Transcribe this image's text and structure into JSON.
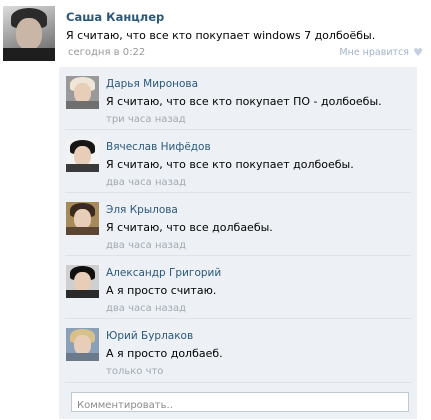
{
  "post": {
    "author": "Саша Канцлер",
    "text": "Я считаю, что все кто покупает windows 7 долбоёбы.",
    "date": "сегодня в 0:22",
    "like_label": "Мне нравится",
    "like_icon": "heart-icon"
  },
  "comments": [
    {
      "name": "Дарья Миронова",
      "text": "Я считаю, что все кто покупает ПО - долбоебы.",
      "time": "три часа назад",
      "avatar_colors": {
        "hair": "#efe6d8",
        "bg": "#9a9a9a",
        "body": "#6f6f6f"
      }
    },
    {
      "name": "Вячеслав Нифёдов",
      "text": "Я считаю, что все кто покупает долбоебы.",
      "time": "два часа назад",
      "avatar_colors": {
        "hair": "#151515",
        "bg": "#f2f2f2",
        "body": "#3a3a3a"
      }
    },
    {
      "name": "Эля Крылова",
      "text": "Я считаю, что все долбаебы.",
      "time": "два часа назад",
      "avatar_colors": {
        "hair": "#3b2a1f",
        "bg": "#a68a5a",
        "body": "#5a4633"
      }
    },
    {
      "name": "Александр Григорий",
      "text": "А я просто считаю.",
      "time": "два часа назад",
      "avatar_colors": {
        "hair": "#101010",
        "bg": "#cfcfcf",
        "body": "#2a2a2a"
      }
    },
    {
      "name": "Юрий Бурлаков",
      "text": "А я просто долбаеб.",
      "time": "только что",
      "avatar_colors": {
        "hair": "#d8c08a",
        "bg": "#8aa0b8",
        "body": "#6a7a8a"
      }
    }
  ],
  "comment_input": {
    "placeholder": "Комментировать.."
  }
}
